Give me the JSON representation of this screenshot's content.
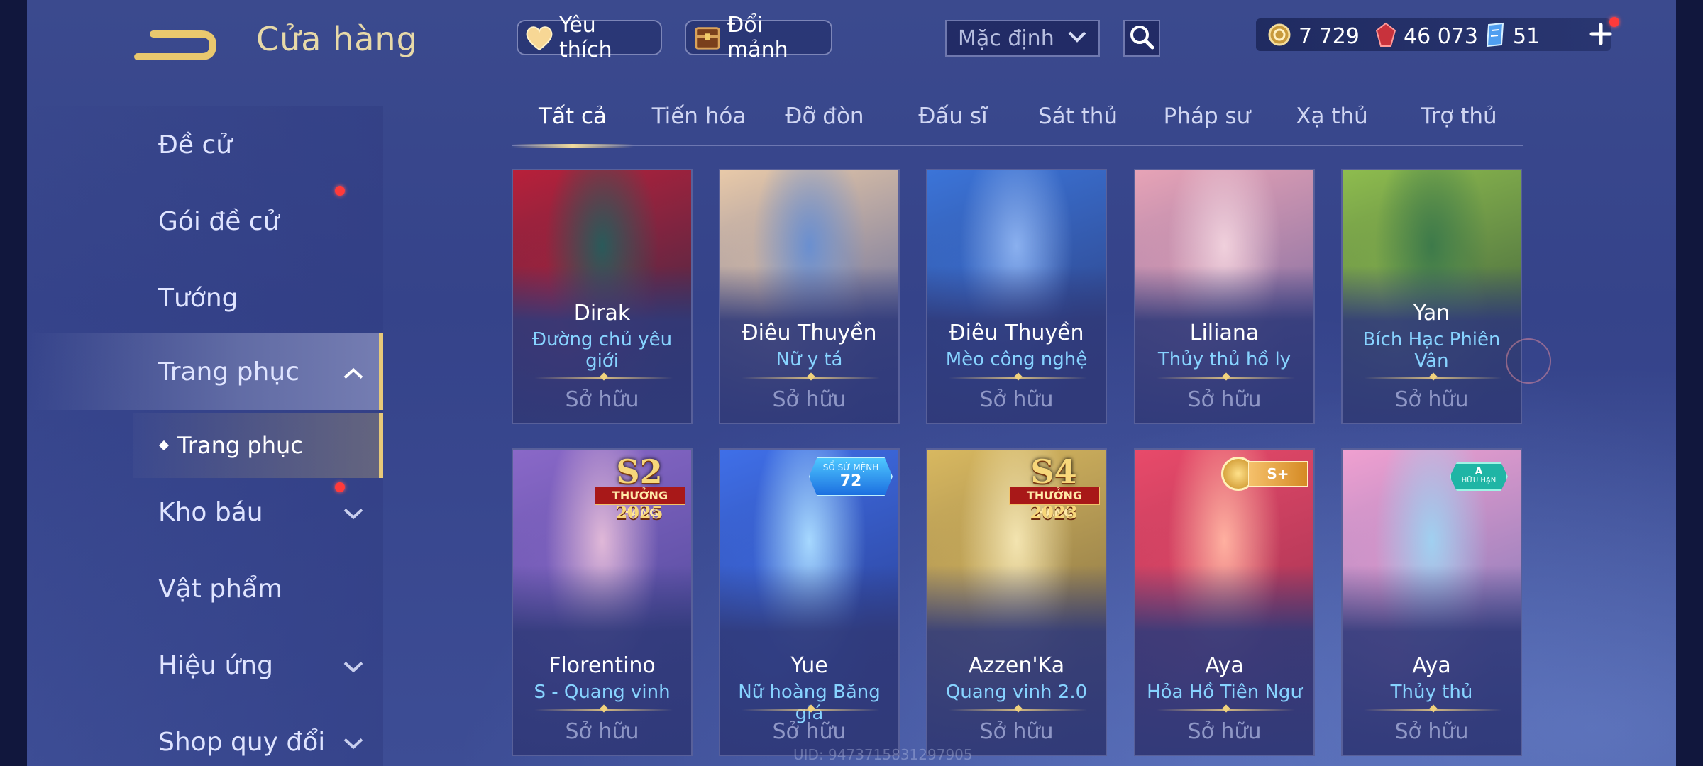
{
  "header": {
    "title": "Cửa hàng",
    "favorites_label": "Yêu thích",
    "shard_label": "Đổi mảnh",
    "sort_value": "Mặc định",
    "currencies": [
      {
        "icon": "gold-coin-icon",
        "value": "7 729"
      },
      {
        "icon": "ruby-gem-icon",
        "value": "46 073"
      },
      {
        "icon": "voucher-card-icon",
        "value": "51"
      }
    ]
  },
  "sidebar": {
    "items": [
      {
        "label": "Đề cử"
      },
      {
        "label": "Gói đề cử"
      },
      {
        "label": "Tướng"
      },
      {
        "label": "Trang phục"
      },
      {
        "label": "Kho báu"
      },
      {
        "label": "Vật phẩm"
      },
      {
        "label": "Hiệu ứng"
      },
      {
        "label": "Shop quy đổi"
      }
    ],
    "sub_item": "Trang phục"
  },
  "tabs": [
    "Tất cả",
    "Tiến hóa",
    "Đỡ đòn",
    "Đấu sĩ",
    "Sát thủ",
    "Pháp sư",
    "Xạ thủ",
    "Trợ thủ"
  ],
  "cards": [
    {
      "hero": "Dirak",
      "skin": "Đường chủ yêu giới",
      "status": "Sở hữu",
      "colors": [
        "#b8203a",
        "#2a5a5a",
        "#1c2c4a"
      ]
    },
    {
      "hero": "Điêu Thuyền",
      "skin": "Nữ y tá",
      "status": "Sở hữu",
      "colors": [
        "#e8c9a8",
        "#6a8fd0",
        "#3c4f98"
      ]
    },
    {
      "hero": "Điêu Thuyền",
      "skin": "Mèo công nghệ",
      "status": "Sở hữu",
      "colors": [
        "#3b74d8",
        "#8ab0ef",
        "#2a3570"
      ]
    },
    {
      "hero": "Liliana",
      "skin": "Thủy thủ hồ ly",
      "status": "Sở hữu",
      "colors": [
        "#e7a3b6",
        "#f0d0dc",
        "#5e5a9a"
      ]
    },
    {
      "hero": "Yan",
      "skin": "Bích Hạc Phiên Vân",
      "status": "Sở hữu",
      "colors": [
        "#8ebc4e",
        "#3d7a4a",
        "#2d4a3a"
      ]
    },
    {
      "hero": "Florentino",
      "skin": "S - Quang vinh",
      "status": "Sở hữu",
      "colors": [
        "#8a68c8",
        "#e0b8d8",
        "#3c3f8c"
      ],
      "badge": {
        "type": "season",
        "big": "S2",
        "ribbon": "THƯỞNG HẠNG",
        "year": "2025"
      }
    },
    {
      "hero": "Yue",
      "skin": "Nữ hoàng Băng giá",
      "status": "Sở hữu",
      "colors": [
        "#3f6fe8",
        "#a6d8ff",
        "#25307a"
      ],
      "badge": {
        "type": "mission",
        "text": "SỔ SỨ MỆNH",
        "value": "72"
      }
    },
    {
      "hero": "Azzen'Ka",
      "skin": "Quang vinh 2.0",
      "status": "Sở hữu",
      "colors": [
        "#d8b860",
        "#f3e4b0",
        "#6a5a3a"
      ],
      "badge": {
        "type": "season",
        "big": "S4",
        "ribbon": "THƯỞNG HẠNG",
        "year": "2023"
      }
    },
    {
      "hero": "Aya",
      "skin": "Hỏa Hồ Tiên Ngư",
      "status": "Sở hữu",
      "colors": [
        "#e84a6a",
        "#ffb0a0",
        "#8a2a4a"
      ],
      "badge": {
        "type": "tier",
        "text": "S+"
      }
    },
    {
      "hero": "Aya",
      "skin": "Thủy thủ",
      "status": "Sở hữu",
      "colors": [
        "#f0a0d0",
        "#a0d0f0",
        "#5a6ab0"
      ],
      "badge": {
        "type": "limited",
        "t1": "A",
        "t2": "HỮU HẠN"
      }
    }
  ],
  "footer": {
    "uid": "UID: 9473715831297905"
  }
}
